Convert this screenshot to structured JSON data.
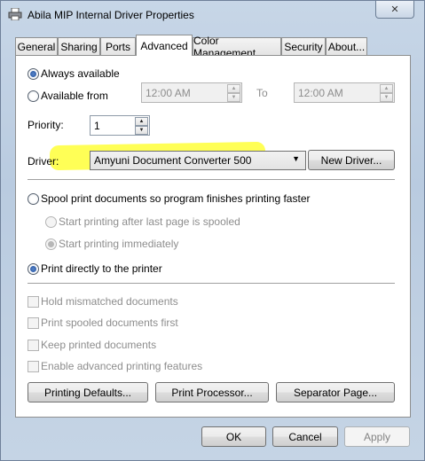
{
  "window": {
    "title": "Abila MIP Internal Driver Properties",
    "close_label": "✕"
  },
  "tabs": [
    {
      "label": "General",
      "active": false
    },
    {
      "label": "Sharing",
      "active": false
    },
    {
      "label": "Ports",
      "active": false
    },
    {
      "label": "Advanced",
      "active": true
    },
    {
      "label": "Color Management",
      "active": false
    },
    {
      "label": "Security",
      "active": false
    },
    {
      "label": "About...",
      "active": false
    }
  ],
  "availability": {
    "always_label": "Always available",
    "from_label": "Available from",
    "from_time": "12:00 AM",
    "to_label": "To",
    "to_time": "12:00 AM",
    "selected": "always"
  },
  "priority": {
    "label": "Priority:",
    "value": "1"
  },
  "driver": {
    "label": "Driver:",
    "value": "Amyuni Document Converter 500",
    "new_driver_button": "New Driver...",
    "highlight_color": "#ffff4d"
  },
  "spooling": {
    "spool_label": "Spool print documents so program finishes printing faster",
    "after_last_page_label": "Start printing after last page is spooled",
    "immediately_label": "Start printing immediately",
    "direct_label": "Print directly to the printer",
    "selected": "direct"
  },
  "options": {
    "hold_mismatched": "Hold mismatched documents",
    "spooled_first": "Print spooled documents first",
    "keep_printed": "Keep printed documents",
    "advanced_features": "Enable advanced printing features"
  },
  "bottom_buttons": {
    "printing_defaults": "Printing Defaults...",
    "print_processor": "Print Processor...",
    "separator_page": "Separator Page..."
  },
  "dialog_buttons": {
    "ok": "OK",
    "cancel": "Cancel",
    "apply": "Apply"
  }
}
